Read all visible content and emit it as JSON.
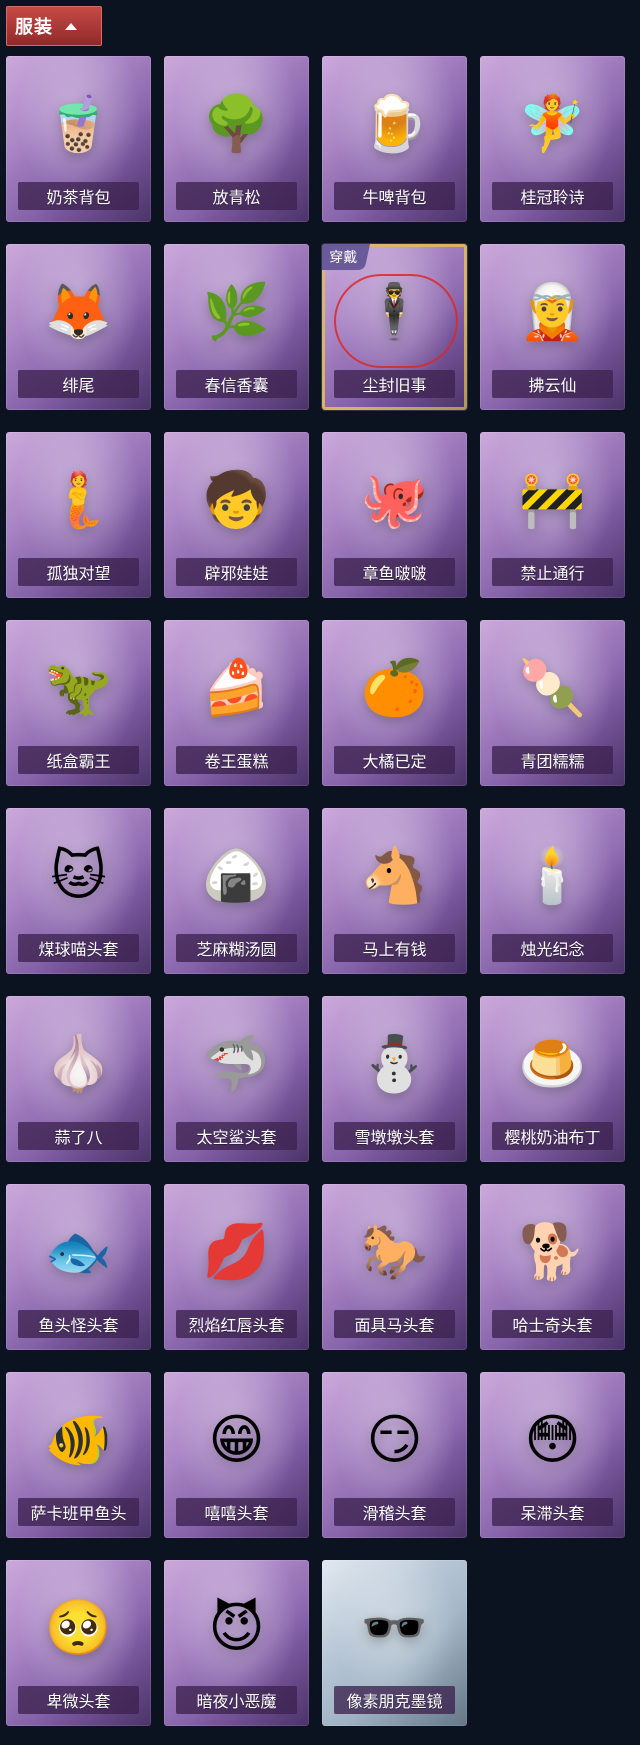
{
  "header": {
    "title": "服装"
  },
  "items": [
    {
      "name": "奶茶背包",
      "icon": "🧋"
    },
    {
      "name": "放青松",
      "icon": "🌳"
    },
    {
      "name": "牛啤背包",
      "icon": "🍺"
    },
    {
      "name": "桂冠聆诗",
      "icon": "🧚"
    },
    {
      "name": "绯尾",
      "icon": "🦊"
    },
    {
      "name": "春信香囊",
      "icon": "🌿"
    },
    {
      "name": "尘封旧事",
      "icon": "🕴️",
      "badge": "穿戴",
      "selected": true
    },
    {
      "name": "拂云仙",
      "icon": "🧝"
    },
    {
      "name": "孤独对望",
      "icon": "🧜"
    },
    {
      "name": "辟邪娃娃",
      "icon": "🧒"
    },
    {
      "name": "章鱼啵啵",
      "icon": "🐙"
    },
    {
      "name": "禁止通行",
      "icon": "🚧"
    },
    {
      "name": "纸盒霸王",
      "icon": "🦖"
    },
    {
      "name": "卷王蛋糕",
      "icon": "🍰"
    },
    {
      "name": "大橘已定",
      "icon": "🍊"
    },
    {
      "name": "青团糯糯",
      "icon": "🍡"
    },
    {
      "name": "煤球喵头套",
      "icon": "🐱"
    },
    {
      "name": "芝麻糊汤圆",
      "icon": "🍙"
    },
    {
      "name": "马上有钱",
      "icon": "🐴"
    },
    {
      "name": "烛光纪念",
      "icon": "🕯️"
    },
    {
      "name": "蒜了八",
      "icon": "🧄"
    },
    {
      "name": "太空鲨头套",
      "icon": "🦈"
    },
    {
      "name": "雪墩墩头套",
      "icon": "⛄"
    },
    {
      "name": "樱桃奶油布丁",
      "icon": "🍮"
    },
    {
      "name": "鱼头怪头套",
      "icon": "🐟"
    },
    {
      "name": "烈焰红唇头套",
      "icon": "💋"
    },
    {
      "name": "面具马头套",
      "icon": "🐎"
    },
    {
      "name": "哈士奇头套",
      "icon": "🐕"
    },
    {
      "name": "萨卡班甲鱼头",
      "icon": "🐠"
    },
    {
      "name": "嘻嘻头套",
      "icon": "😁"
    },
    {
      "name": "滑稽头套",
      "icon": "😏"
    },
    {
      "name": "呆滞头套",
      "icon": "😳"
    },
    {
      "name": "卑微头套",
      "icon": "🥺"
    },
    {
      "name": "暗夜小恶魔",
      "icon": "😈"
    },
    {
      "name": "像素朋克墨镜",
      "icon": "🕶️",
      "mono": true
    }
  ]
}
